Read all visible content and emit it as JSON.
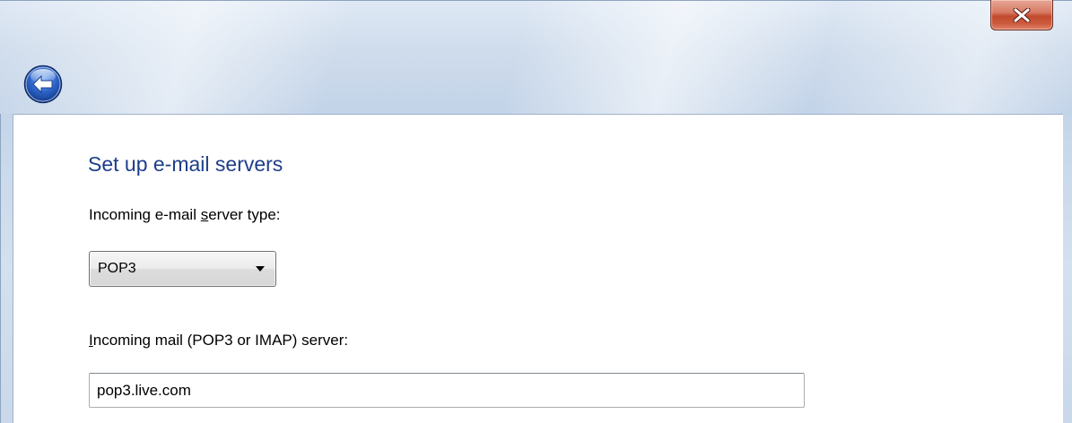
{
  "window": {
    "close_label": "X"
  },
  "icons": {
    "back": "back-arrow-icon",
    "close": "close-x-icon",
    "dropdown": "chevron-down-icon"
  },
  "page": {
    "heading": "Set up e-mail servers"
  },
  "server_type": {
    "label_pre": "Incoming e-mail ",
    "label_access": "s",
    "label_post": "erver type:",
    "selected": "POP3"
  },
  "incoming_server": {
    "label_access": "I",
    "label_post": "ncoming mail (POP3 or IMAP) server:",
    "value": "pop3.live.com"
  },
  "colors": {
    "heading": "#1e3e8a",
    "close_button": "#c24a2e",
    "back_button": "#2d64c8"
  }
}
